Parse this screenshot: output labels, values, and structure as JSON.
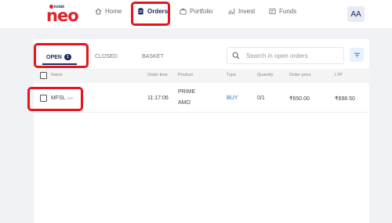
{
  "brand": {
    "maker": "kotak",
    "name": "neo"
  },
  "nav": {
    "home": "Home",
    "orders": "Orders",
    "portfolio": "Portfolio",
    "invest": "Invest",
    "funds": "Funds",
    "avatar": "AA"
  },
  "tabs": {
    "open": "OPEN",
    "open_count": "1",
    "closed": "CLOSED",
    "basket": "BASKET"
  },
  "search": {
    "placeholder": "Search in open orders"
  },
  "columns": {
    "name": "Name",
    "order_time": "Order time",
    "product": "Product",
    "type": "Type",
    "quantity": "Quantity",
    "order_price": "Order price",
    "ltp": "LTP"
  },
  "orders": [
    {
      "symbol": "MFSL",
      "exchange": "NSE",
      "order_time": "11:17:06",
      "product_line1": "PRIME",
      "product_line2": "AMO",
      "type": "BUY",
      "quantity": "0/1",
      "order_price": "₹650.00",
      "ltp": "₹698.50"
    }
  ],
  "colors": {
    "brand_red": "#e42028",
    "navy": "#1c2a5a",
    "buy_blue": "#1e6fd0",
    "highlight": "#e8141c"
  }
}
